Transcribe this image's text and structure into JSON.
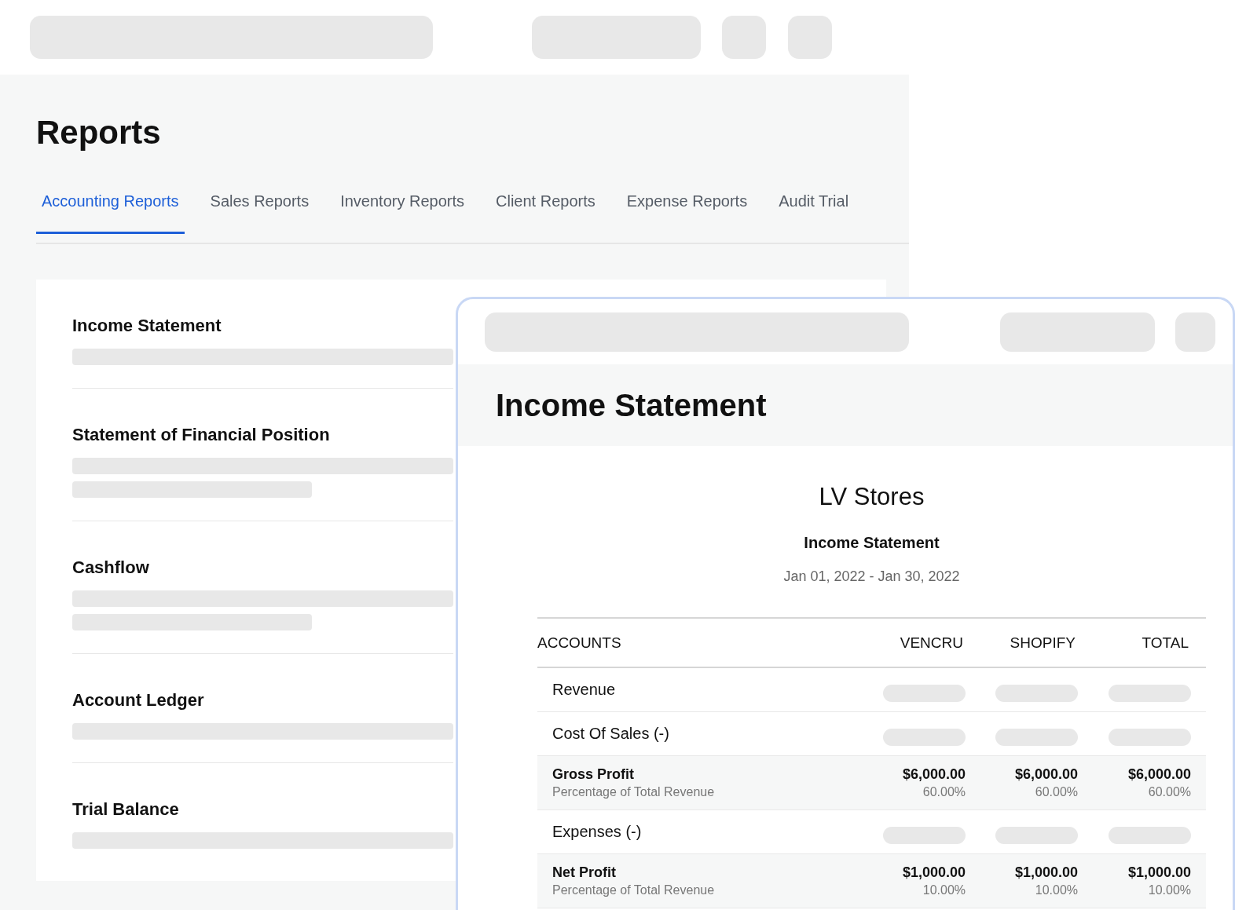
{
  "reports": {
    "title": "Reports",
    "tabs": [
      {
        "label": "Accounting Reports",
        "selected": true
      },
      {
        "label": "Sales Reports",
        "selected": false
      },
      {
        "label": "Inventory Reports",
        "selected": false
      },
      {
        "label": "Client Reports",
        "selected": false
      },
      {
        "label": "Expense Reports",
        "selected": false
      },
      {
        "label": "Audit Trial",
        "selected": false
      }
    ],
    "items": [
      {
        "title": "Income Statement",
        "kind": "single"
      },
      {
        "title": "Statement of Financial Position",
        "kind": "double"
      },
      {
        "title": "Cashflow",
        "kind": "double"
      },
      {
        "title": "Account Ledger",
        "kind": "single"
      },
      {
        "title": "Trial Balance",
        "kind": "single"
      }
    ]
  },
  "statement": {
    "title": "Income Statement",
    "company": "LV Stores",
    "report_name": "Income Statement",
    "period": "Jan 01, 2022 - Jan 30, 2022",
    "columns": [
      "ACCOUNTS",
      "VENCRU",
      "SHOPIFY",
      "TOTAL"
    ],
    "rows": [
      {
        "kind": "pending",
        "label": "Revenue"
      },
      {
        "kind": "pending",
        "label": "Cost Of Sales (-)"
      },
      {
        "kind": "total",
        "label": "Gross Profit",
        "sublabel": "Percentage of Total Revenue",
        "values": [
          {
            "amount": "$6,000.00",
            "percent": "60.00%"
          },
          {
            "amount": "$6,000.00",
            "percent": "60.00%"
          },
          {
            "amount": "$6,000.00",
            "percent": "60.00%"
          }
        ]
      },
      {
        "kind": "pending",
        "label": "Expenses (-)"
      },
      {
        "kind": "total",
        "label": "Net Profit",
        "sublabel": "Percentage of Total Revenue",
        "values": [
          {
            "amount": "$1,000.00",
            "percent": "10.00%"
          },
          {
            "amount": "$1,000.00",
            "percent": "10.00%"
          },
          {
            "amount": "$1,000.00",
            "percent": "10.00%"
          }
        ]
      }
    ]
  }
}
